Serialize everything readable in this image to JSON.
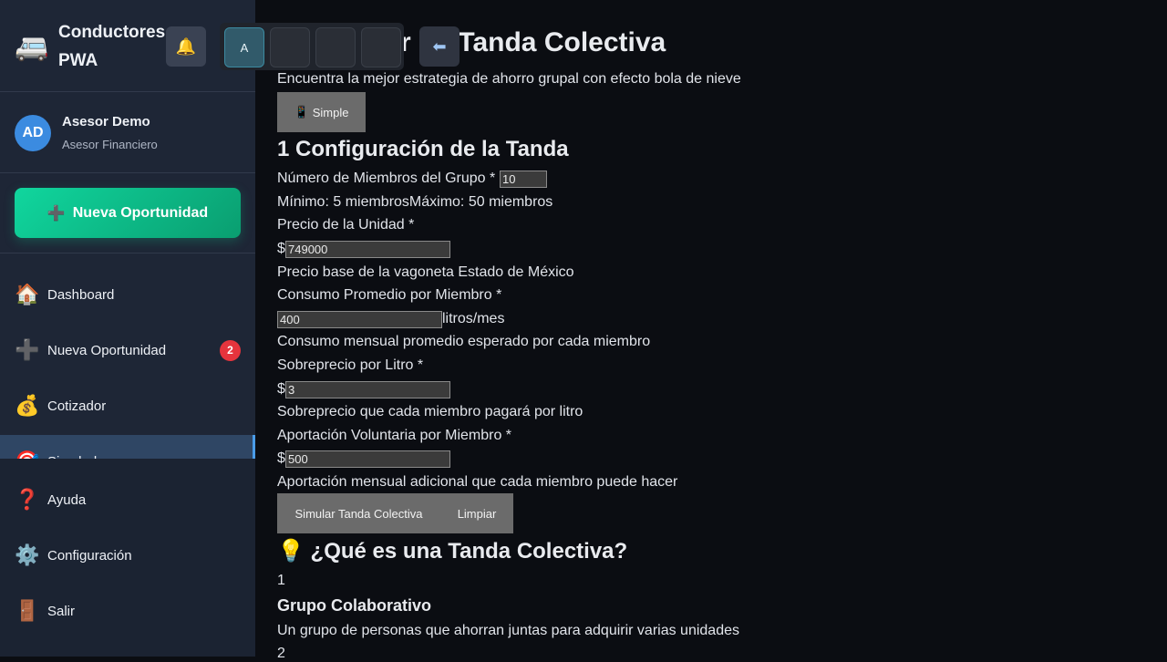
{
  "sidebar": {
    "brand_icon": "🚐",
    "brand_title": "Conductores PWA",
    "bell_icon": "🔔",
    "user": {
      "initials": "AD",
      "name": "Asesor Demo",
      "role": "Asesor Financiero"
    },
    "new_opportunity": {
      "icon": "➕",
      "label": "Nueva Oportunidad"
    },
    "nav": [
      {
        "icon": "🏠",
        "label": "Dashboard"
      },
      {
        "icon": "➕",
        "label": "Nueva Oportunidad",
        "badge": "2"
      },
      {
        "icon": "💰",
        "label": "Cotizador"
      },
      {
        "icon": "🎯",
        "label": "Simulador"
      }
    ],
    "bottom_nav": [
      {
        "icon": "❓",
        "label": "Ayuda"
      },
      {
        "icon": "⚙️",
        "label": "Configuración"
      },
      {
        "icon": "🚪",
        "label": "Salir"
      }
    ]
  },
  "overlay": {
    "buttons": [
      "A",
      "",
      "",
      ""
    ],
    "back_icon": "⬅"
  },
  "main": {
    "title": "Simulador de Tanda Colectiva",
    "subtitle": "Encuentra la mejor estrategia de ahorro grupal con efecto bola de nieve",
    "mode_button": {
      "icon": "📱",
      "label": "Simple"
    },
    "config_title": "1 Configuración de la Tanda",
    "members": {
      "label": "Número de Miembros del Grupo *",
      "value": "10",
      "hint": "Mínimo: 5 miembrosMáximo: 50 miembros"
    },
    "unit_price": {
      "label": "Precio de la Unidad *",
      "prefix": "$",
      "value": "749000",
      "hint": "Precio base de la vagoneta Estado de México"
    },
    "consumption": {
      "label": "Consumo Promedio por Miembro *",
      "value": "400",
      "suffix": "litros/mes",
      "hint": "Consumo mensual promedio esperado por cada miembro"
    },
    "surcharge": {
      "label": "Sobreprecio por Litro *",
      "prefix": "$",
      "value": "3",
      "hint": "Sobreprecio que cada miembro pagará por litro"
    },
    "contribution": {
      "label": "Aportación Voluntaria por Miembro *",
      "prefix": "$",
      "value": "500",
      "hint": "Aportación mensual adicional que cada miembro puede hacer"
    },
    "simulate_button": "Simular Tanda Colectiva",
    "clear_button": "Limpiar",
    "info_title": "💡 ¿Qué es una Tanda Colectiva?",
    "steps": [
      {
        "num": "1",
        "title": "Grupo Colaborativo",
        "desc": "Un grupo de personas que ahorran juntas para adquirir varias unidades"
      },
      {
        "num": "2"
      }
    ]
  }
}
